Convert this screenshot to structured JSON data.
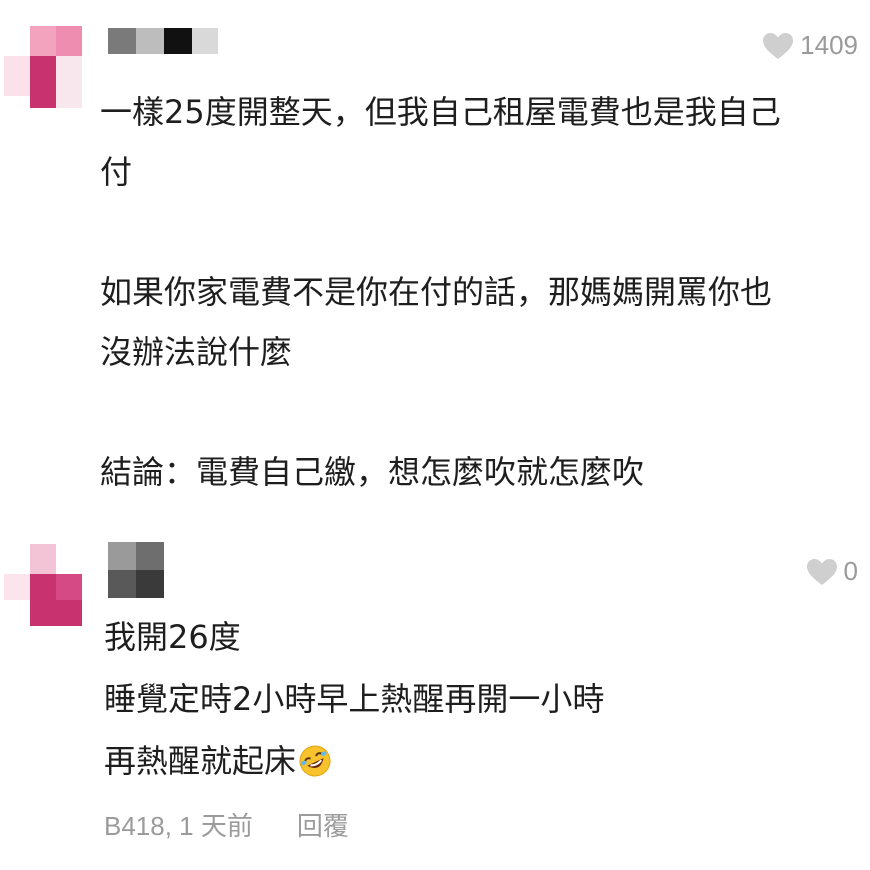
{
  "comments": [
    {
      "likes": "1409",
      "lines": [
        "一樣25度開整天，但我自己租屋電費也是我自己",
        "付",
        "",
        "如果你家電費不是你在付的話，那媽媽開罵你也",
        "沒辦法說什麼",
        "",
        "結論：電費自己繳，想怎麼吹就怎麼吹"
      ]
    },
    {
      "likes": "0",
      "lines": [
        "我開26度",
        "睡覺定時2小時早上熱醒再開一小時",
        "再熱醒就起床"
      ],
      "emoji": "rolling-on-floor-laughing",
      "meta_user": "B418, 1 天前",
      "meta_reply": "回覆"
    }
  ],
  "colors": {
    "heart": "#cfcfcf",
    "meta_text": "#9b9b9b",
    "avatar_pink": "#c7326f"
  }
}
